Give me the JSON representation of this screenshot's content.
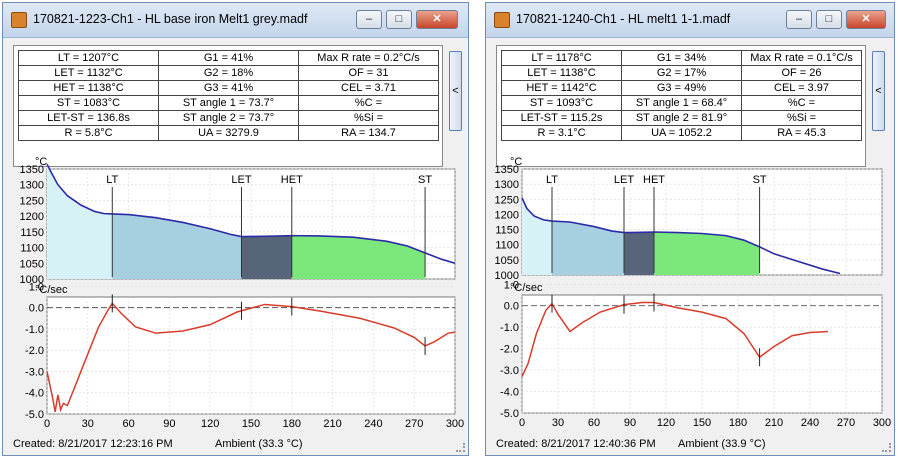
{
  "windows": [
    {
      "id": "A",
      "title": "170821-1223-Ch1 - HL base iron Melt1 grey.madf",
      "buttons": {
        "minimize": "–",
        "maximize": "□",
        "close": "✕"
      },
      "side_tab_label": "<",
      "params_rows": [
        [
          "LT = 1207°C",
          "G1 = 41%",
          "Max R rate = 0.2°C/s"
        ],
        [
          "LET = 1132°C",
          "G2 = 18%",
          "OF = 31"
        ],
        [
          "HET = 1138°C",
          "G3 = 41%",
          "CEL = 3.71"
        ],
        [
          "ST = 1083°C",
          "ST angle 1 = 73.7°",
          "%C ="
        ],
        [
          "LET-ST = 136.8s",
          "ST angle 2 = 73.7°",
          "%Si ="
        ],
        [
          "R = 5.8°C",
          "UA = 3279.9",
          "RA = 134.7"
        ]
      ],
      "status": {
        "created": "Created: 8/21/2017 12:23:16 PM",
        "ambient": "Ambient (33.3 °C)"
      },
      "chart_data": {
        "type": "line",
        "x_ticks": [
          "0",
          "30",
          "60",
          "90",
          "120",
          "150",
          "180",
          "210",
          "240",
          "270",
          "300"
        ],
        "xlim": [
          0,
          300
        ],
        "top": {
          "ylabel": "°C",
          "ylim": [
            1000,
            1350
          ],
          "y_ticks": [
            "1000",
            "1050",
            "1100",
            "1150",
            "1200",
            "1250",
            "1300",
            "1350"
          ],
          "markers": [
            {
              "label": "LT",
              "x": 48
            },
            {
              "label": "LET",
              "x": 143
            },
            {
              "label": "HET",
              "x": 180
            },
            {
              "label": "ST",
              "x": 278
            }
          ],
          "curve": [
            [
              0,
              1365
            ],
            [
              3,
              1340
            ],
            [
              8,
              1300
            ],
            [
              15,
              1265
            ],
            [
              25,
              1235
            ],
            [
              35,
              1215
            ],
            [
              42,
              1208
            ],
            [
              48,
              1207
            ],
            [
              60,
              1205
            ],
            [
              80,
              1195
            ],
            [
              100,
              1180
            ],
            [
              120,
              1160
            ],
            [
              135,
              1142
            ],
            [
              143,
              1135
            ],
            [
              160,
              1136
            ],
            [
              180,
              1138
            ],
            [
              200,
              1137
            ],
            [
              225,
              1133
            ],
            [
              250,
              1120
            ],
            [
              265,
              1105
            ],
            [
              278,
              1083
            ],
            [
              290,
              1063
            ],
            [
              300,
              1050
            ]
          ],
          "regions": [
            {
              "x0": 0,
              "x1": 48,
              "color": "#d7f2f7"
            },
            {
              "x0": 48,
              "x1": 143,
              "color": "#a6cfe0"
            },
            {
              "x0": 143,
              "x1": 180,
              "color": "#56657a"
            },
            {
              "x0": 180,
              "x1": 278,
              "color": "#7ce87c"
            }
          ]
        },
        "bottom": {
          "ylabel": "°C/sec",
          "ylim": [
            -5,
            0.5
          ],
          "y_ticks": [
            "-5.0",
            "-4.0",
            "-3.0",
            "-2.0",
            "-1.0",
            "0.0",
            "1.0"
          ],
          "curve": [
            [
              0,
              -3.0
            ],
            [
              4,
              -4.2
            ],
            [
              6,
              -4.9
            ],
            [
              8,
              -4.1
            ],
            [
              10,
              -4.8
            ],
            [
              12,
              -4.5
            ],
            [
              15,
              -4.6
            ],
            [
              20,
              -3.8
            ],
            [
              28,
              -2.5
            ],
            [
              38,
              -0.9
            ],
            [
              45,
              -0.1
            ],
            [
              48,
              0.2
            ],
            [
              55,
              -0.3
            ],
            [
              65,
              -0.9
            ],
            [
              80,
              -1.2
            ],
            [
              100,
              -1.1
            ],
            [
              120,
              -0.8
            ],
            [
              140,
              -0.2
            ],
            [
              160,
              0.15
            ],
            [
              180,
              0.05
            ],
            [
              200,
              -0.15
            ],
            [
              230,
              -0.5
            ],
            [
              255,
              -0.95
            ],
            [
              270,
              -1.4
            ],
            [
              278,
              -1.8
            ],
            [
              285,
              -1.6
            ],
            [
              295,
              -1.2
            ],
            [
              300,
              -1.15
            ]
          ],
          "ticks": [
            48,
            143,
            180,
            278
          ]
        }
      }
    },
    {
      "id": "B",
      "title": "170821-1240-Ch1 - HL melt1 1-1.madf",
      "buttons": {
        "minimize": "–",
        "maximize": "□",
        "close": "✕"
      },
      "side_tab_label": "<",
      "params_rows": [
        [
          "LT = 1178°C",
          "G1 = 34%",
          "Max R rate = 0.1°C/s"
        ],
        [
          "LET = 1138°C",
          "G2 = 17%",
          "OF = 26"
        ],
        [
          "HET = 1142°C",
          "G3 = 49%",
          "CEL = 3.97"
        ],
        [
          "ST = 1093°C",
          "ST angle 1 = 68.4°",
          "%C ="
        ],
        [
          "LET-ST = 115.2s",
          "ST angle 2 = 81.9°",
          "%Si ="
        ],
        [
          "R = 3.1°C",
          "UA = 1052.2",
          "RA = 45.3"
        ]
      ],
      "status": {
        "created": "Created: 8/21/2017 12:40:36 PM",
        "ambient": "Ambient (33.9 °C)"
      },
      "chart_data": {
        "type": "line",
        "x_ticks": [
          "0",
          "30",
          "60",
          "90",
          "120",
          "150",
          "180",
          "210",
          "240",
          "270",
          "300"
        ],
        "xlim": [
          0,
          300
        ],
        "top": {
          "ylabel": "°C",
          "ylim": [
            1000,
            1350
          ],
          "y_ticks": [
            "1000",
            "1050",
            "1100",
            "1150",
            "1200",
            "1250",
            "1300",
            "1350"
          ],
          "markers": [
            {
              "label": "LT",
              "x": 25
            },
            {
              "label": "LET",
              "x": 85
            },
            {
              "label": "HET",
              "x": 110
            },
            {
              "label": "ST",
              "x": 198
            }
          ],
          "curve": [
            [
              0,
              1255
            ],
            [
              4,
              1220
            ],
            [
              10,
              1195
            ],
            [
              18,
              1182
            ],
            [
              25,
              1178
            ],
            [
              40,
              1175
            ],
            [
              60,
              1160
            ],
            [
              75,
              1145
            ],
            [
              85,
              1140
            ],
            [
              100,
              1141
            ],
            [
              110,
              1142
            ],
            [
              130,
              1140
            ],
            [
              150,
              1137
            ],
            [
              170,
              1130
            ],
            [
              185,
              1115
            ],
            [
              198,
              1093
            ],
            [
              210,
              1070
            ],
            [
              230,
              1045
            ],
            [
              250,
              1020
            ],
            [
              265,
              1005
            ]
          ],
          "regions": [
            {
              "x0": 0,
              "x1": 25,
              "color": "#d7f2f7"
            },
            {
              "x0": 25,
              "x1": 85,
              "color": "#a6cfe0"
            },
            {
              "x0": 85,
              "x1": 110,
              "color": "#56657a"
            },
            {
              "x0": 110,
              "x1": 198,
              "color": "#7ce87c"
            }
          ]
        },
        "bottom": {
          "ylabel": "°C/sec",
          "ylim": [
            -5,
            0.5
          ],
          "y_ticks": [
            "-5.0",
            "-4.0",
            "-3.0",
            "-2.0",
            "-1.0",
            "0.0",
            "1.0"
          ],
          "curve": [
            [
              0,
              -3.3
            ],
            [
              5,
              -2.7
            ],
            [
              12,
              -1.3
            ],
            [
              20,
              -0.2
            ],
            [
              25,
              0.1
            ],
            [
              30,
              -0.4
            ],
            [
              40,
              -1.2
            ],
            [
              50,
              -0.8
            ],
            [
              65,
              -0.3
            ],
            [
              85,
              0.05
            ],
            [
              100,
              0.15
            ],
            [
              110,
              0.15
            ],
            [
              130,
              -0.1
            ],
            [
              150,
              -0.3
            ],
            [
              170,
              -0.6
            ],
            [
              185,
              -1.3
            ],
            [
              198,
              -2.4
            ],
            [
              210,
              -1.9
            ],
            [
              225,
              -1.4
            ],
            [
              240,
              -1.25
            ],
            [
              255,
              -1.2
            ]
          ],
          "ticks": [
            25,
            85,
            110,
            198
          ]
        }
      }
    }
  ]
}
